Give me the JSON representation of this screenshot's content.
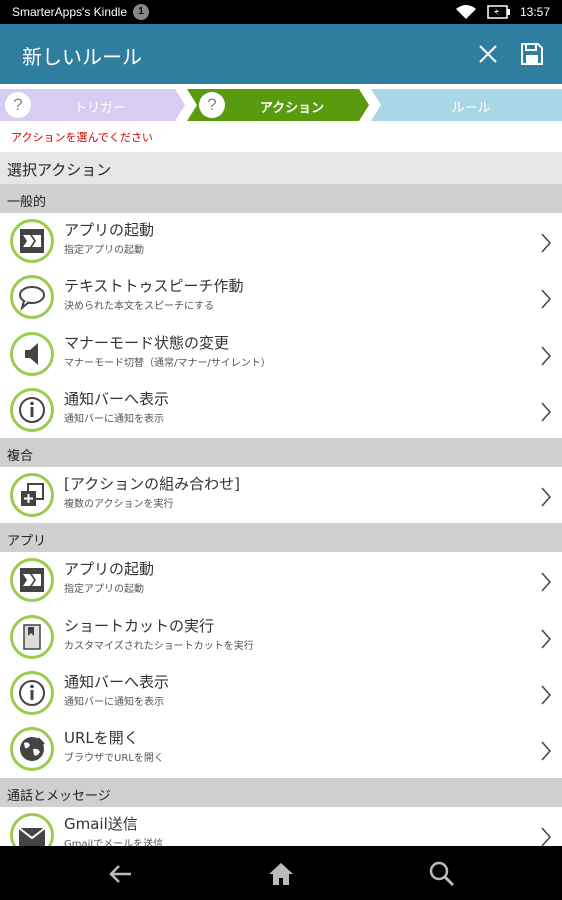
{
  "status_bar": {
    "app_name": "SmarterApps's Kindle",
    "notification_count": "1",
    "time": "13:57"
  },
  "app_bar": {
    "title": "新しいルール"
  },
  "steps": [
    {
      "label": "トリガー",
      "icon": "?"
    },
    {
      "label": "アクション",
      "icon": "?"
    },
    {
      "label": "ルール"
    }
  ],
  "instruction": "アクションを選んでください",
  "list_header": "選択アクション",
  "sections": [
    {
      "title": "一般的",
      "items": [
        {
          "title": "アプリの起動",
          "subtitle": "指定アプリの起動",
          "icon": "launch-app-icon"
        },
        {
          "title": "テキストトゥスピーチ作動",
          "subtitle": "決められた本文をスピーチにする",
          "icon": "speech-bubble-icon"
        },
        {
          "title": "マナーモード状態の変更",
          "subtitle": "マナーモード切替（通常/マナー/サイレント）",
          "icon": "speaker-icon"
        },
        {
          "title": "通知バーへ表示",
          "subtitle": "通知バーに通知を表示",
          "icon": "info-icon"
        }
      ]
    },
    {
      "title": "複合",
      "items": [
        {
          "title": "[アクションの組み合わせ]",
          "subtitle": "複数のアクションを実行",
          "icon": "combine-icon"
        }
      ]
    },
    {
      "title": "アプリ",
      "items": [
        {
          "title": "アプリの起動",
          "subtitle": "指定アプリの起動",
          "icon": "launch-app-icon"
        },
        {
          "title": "ショートカットの実行",
          "subtitle": "カスタマイズされたショートカットを実行",
          "icon": "shortcut-icon"
        },
        {
          "title": "通知バーへ表示",
          "subtitle": "通知バーに通知を表示",
          "icon": "info-icon"
        },
        {
          "title": "URLを開く",
          "subtitle": "ブラウザでURLを開く",
          "icon": "globe-icon"
        }
      ]
    },
    {
      "title": "通話とメッセージ",
      "items": [
        {
          "title": "Gmail送信",
          "subtitle": "Gmailでメールを送信",
          "icon": "mail-icon"
        }
      ]
    }
  ],
  "colors": {
    "app_bar": "#2f7e9f",
    "step_trigger": "#d9ccf2",
    "step_action": "#5a9a0e",
    "step_rule": "#a9d7e6",
    "icon_ring": "#9ccc4f",
    "instruction": "#d40000"
  }
}
